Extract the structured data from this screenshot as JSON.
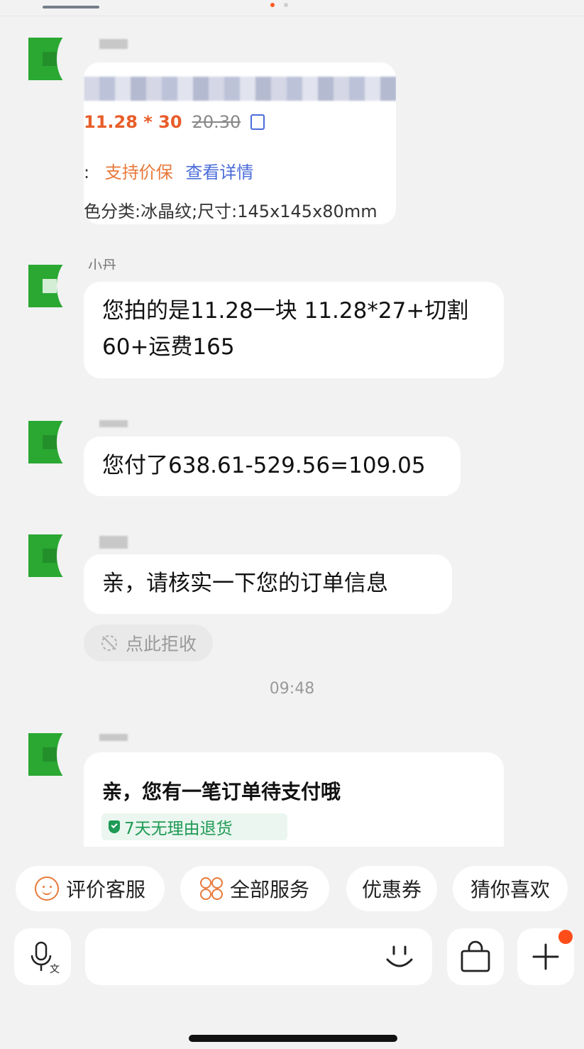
{
  "product_card": {
    "price": "11.28 * 30",
    "original_price": "20.30",
    "price_protect_prefix": ":",
    "price_protect": "支持价保",
    "view_details": "查看详情",
    "spec": "色分类:冰晶纹;尺寸:145x145x80mm"
  },
  "sender_label_partial": "小丹",
  "messages": [
    {
      "text": "您拍的是11.28一块 11.28*27+切割60+运费165"
    },
    {
      "text": "您付了638.61-529.56=109.05"
    },
    {
      "text": "亲，请核实一下您的订单信息"
    }
  ],
  "reject_label": "点此拒收",
  "timestamp": "09:48",
  "order_card": {
    "title": "亲，您有一笔订单待支付哦",
    "badge": "7天无理由退货"
  },
  "quick_actions": [
    {
      "label": "评价客服",
      "icon": "smile-icon"
    },
    {
      "label": "全部服务",
      "icon": "grid-icon"
    },
    {
      "label": "优惠券"
    },
    {
      "label": "猜你喜欢"
    }
  ],
  "colors": {
    "avatar": "#2aa832",
    "accent_orange": "#e8793a",
    "link_blue": "#4a6cd8",
    "badge_green": "#1e9a55",
    "notification": "#ff4d1a"
  }
}
